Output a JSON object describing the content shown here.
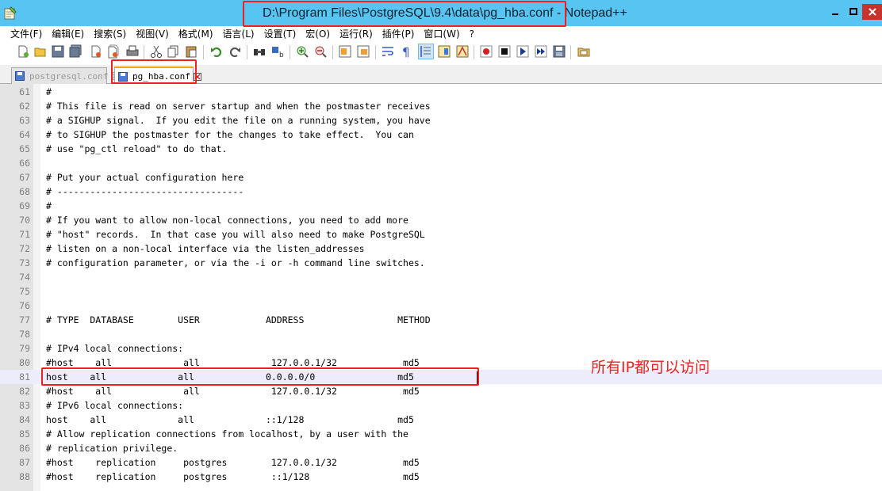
{
  "window": {
    "title": "D:\\Program Files\\PostgreSQL\\9.4\\data\\pg_hba.conf - Notepad++",
    "app_icon": "notepad-icon"
  },
  "menu": [
    "文件(F)",
    "编辑(E)",
    "搜索(S)",
    "视图(V)",
    "格式(M)",
    "语言(L)",
    "设置(T)",
    "宏(O)",
    "运行(R)",
    "插件(P)",
    "窗口(W)",
    "?"
  ],
  "toolbar": {
    "buttons": [
      "new-file-icon",
      "open-file-icon",
      "save-icon",
      "save-all-icon",
      "close-icon",
      "close-all-icon",
      "print-icon",
      "cut-icon",
      "copy-icon",
      "paste-icon",
      "undo-icon",
      "redo-icon",
      "find-icon",
      "replace-icon",
      "zoom-in-icon",
      "zoom-out-icon",
      "sync-vertical-icon",
      "sync-horizontal-icon",
      "word-wrap-icon",
      "show-all-chars-icon",
      "indent-guide-icon",
      "doc-map-icon",
      "function-list-icon",
      "record-macro-icon",
      "stop-macro-icon",
      "play-macro-icon",
      "run-macro-multiple-icon",
      "save-macro-icon",
      "folder-workspace-icon"
    ]
  },
  "tabs": [
    {
      "label": "postgresql.conf",
      "active": false
    },
    {
      "label": "pg_hba.conf",
      "active": true
    }
  ],
  "editor": {
    "current_line": 81,
    "lines": [
      {
        "n": "61",
        "text": "#"
      },
      {
        "n": "62",
        "text": "# This file is read on server startup and when the postmaster receives"
      },
      {
        "n": "63",
        "text": "# a SIGHUP signal.  If you edit the file on a running system, you have"
      },
      {
        "n": "64",
        "text": "# to SIGHUP the postmaster for the changes to take effect.  You can"
      },
      {
        "n": "65",
        "text": "# use \"pg_ctl reload\" to do that."
      },
      {
        "n": "66",
        "text": ""
      },
      {
        "n": "67",
        "text": "# Put your actual configuration here"
      },
      {
        "n": "68",
        "text": "# ----------------------------------"
      },
      {
        "n": "69",
        "text": "#"
      },
      {
        "n": "70",
        "text": "# If you want to allow non-local connections, you need to add more"
      },
      {
        "n": "71",
        "text": "# \"host\" records.  In that case you will also need to make PostgreSQL"
      },
      {
        "n": "72",
        "text": "# listen on a non-local interface via the listen_addresses"
      },
      {
        "n": "73",
        "text": "# configuration parameter, or via the -i or -h command line switches."
      },
      {
        "n": "74",
        "text": ""
      },
      {
        "n": "75",
        "text": ""
      },
      {
        "n": "76",
        "text": ""
      },
      {
        "n": "77",
        "text": "# TYPE  DATABASE        USER            ADDRESS                 METHOD"
      },
      {
        "n": "78",
        "text": ""
      },
      {
        "n": "79",
        "text": "# IPv4 local connections:"
      },
      {
        "n": "80",
        "text": "#host    all             all             127.0.0.1/32            md5"
      },
      {
        "n": "81",
        "text": "host    all             all             0.0.0.0/0               md5"
      },
      {
        "n": "82",
        "text": "#host    all             all             127.0.0.1/32            md5"
      },
      {
        "n": "83",
        "text": "# IPv6 local connections:"
      },
      {
        "n": "84",
        "text": "host    all             all             ::1/128                 md5"
      },
      {
        "n": "85",
        "text": "# Allow replication connections from localhost, by a user with the"
      },
      {
        "n": "86",
        "text": "# replication privilege."
      },
      {
        "n": "87",
        "text": "#host    replication     postgres        127.0.0.1/32            md5"
      },
      {
        "n": "88",
        "text": "#host    replication     postgres        ::1/128                 md5"
      }
    ]
  },
  "annotation": {
    "text": "所有IP都可以访问",
    "color": "#ee2020"
  },
  "colors": {
    "titlebar": "#57c4f2",
    "highlight_box": "#ee2020",
    "current_line": "#ececfa"
  }
}
